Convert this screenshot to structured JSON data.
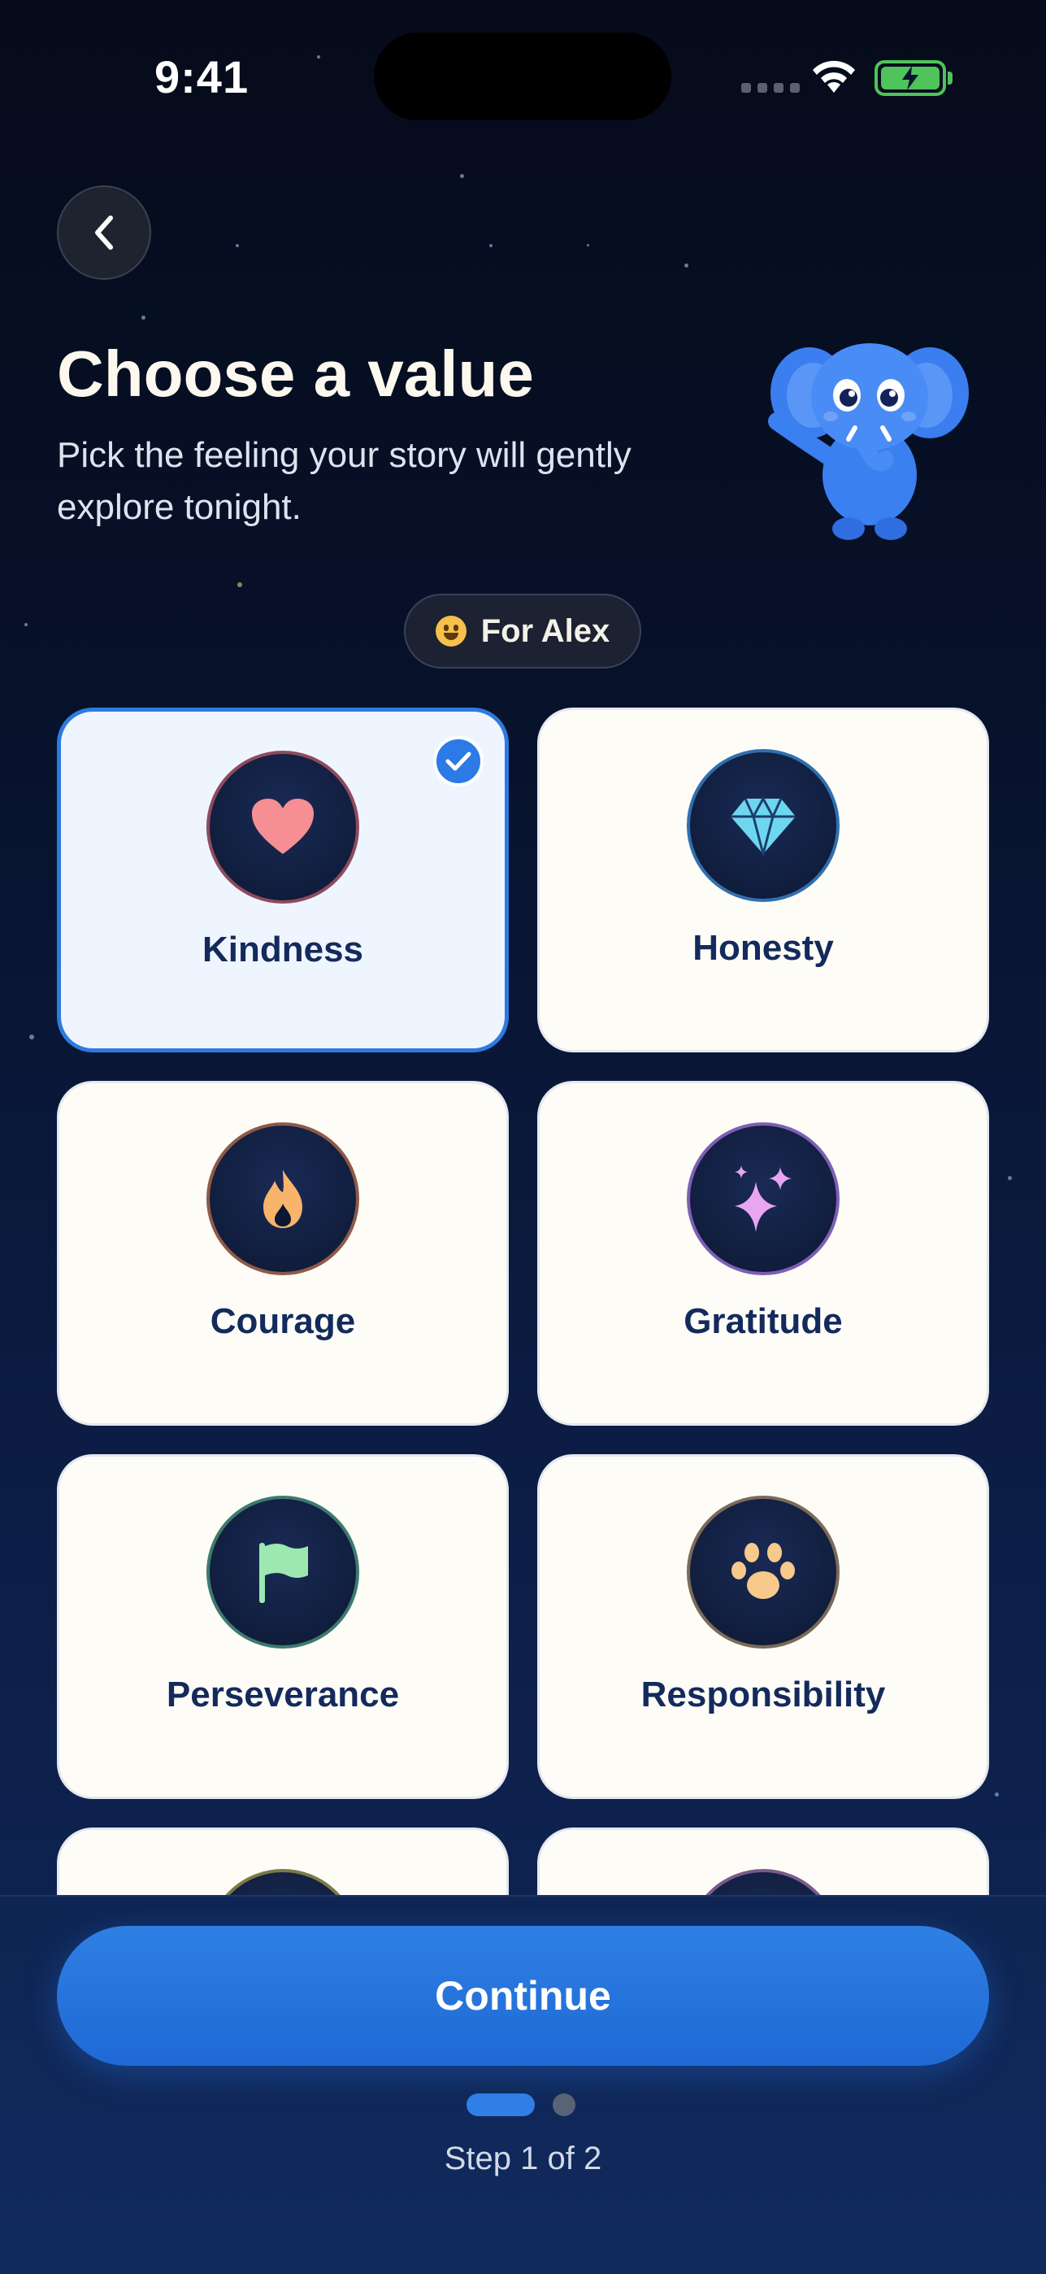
{
  "status_bar": {
    "time": "9:41"
  },
  "header": {
    "title": "Choose a value",
    "subtitle": "Pick the feeling your story will gently explore tonight."
  },
  "profile_chip": {
    "label": "For Alex"
  },
  "values": [
    {
      "label": "Kindness",
      "icon": "heart-icon",
      "selected": true
    },
    {
      "label": "Honesty",
      "icon": "diamond-icon",
      "selected": false
    },
    {
      "label": "Courage",
      "icon": "flame-icon",
      "selected": false
    },
    {
      "label": "Gratitude",
      "icon": "sparkles-icon",
      "selected": false
    },
    {
      "label": "Perseverance",
      "icon": "flag-icon",
      "selected": false
    },
    {
      "label": "Responsibility",
      "icon": "paw-icon",
      "selected": false
    }
  ],
  "footer": {
    "continue_label": "Continue",
    "step_text": "Step 1 of 2"
  }
}
